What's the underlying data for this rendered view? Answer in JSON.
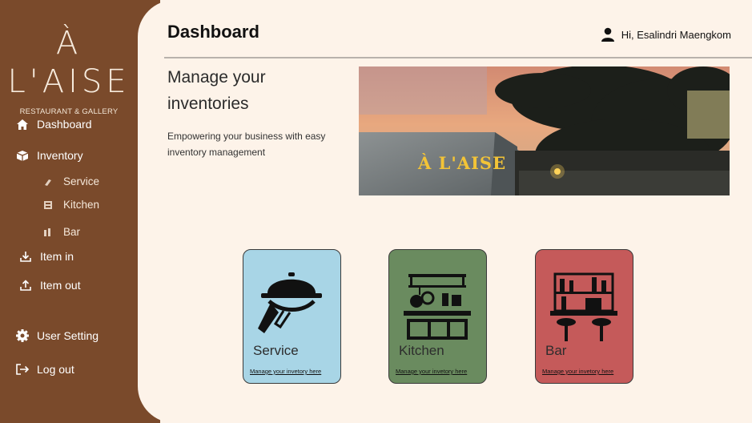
{
  "brand": {
    "logo_text": "À L'AISE",
    "subtitle": "RESTAURANT & GALLERY"
  },
  "sidebar": {
    "items": [
      {
        "label": "Dashboard",
        "icon": "home-icon"
      },
      {
        "label": "Inventory",
        "icon": "box-icon"
      },
      {
        "label": "Service",
        "icon": "service-icon"
      },
      {
        "label": "Kitchen",
        "icon": "kitchen-icon"
      },
      {
        "label": "Bar",
        "icon": "bar-icon"
      },
      {
        "label": "Item in",
        "icon": "download-icon"
      },
      {
        "label": "Item out",
        "icon": "upload-icon"
      },
      {
        "label": "User Setting",
        "icon": "gear-icon"
      },
      {
        "label": "Log out",
        "icon": "logout-icon"
      }
    ]
  },
  "header": {
    "title": "Dashboard",
    "greeting": "Hi, Esalindri Maengkom"
  },
  "hero": {
    "title": "Manage your inventories",
    "description": "Empowering your business with easy inventory management",
    "sign_text": "À L'AISE"
  },
  "cards": [
    {
      "label": "Service",
      "link": "Manage your invetory here",
      "color": "#a8d5e6"
    },
    {
      "label": "Kitchen",
      "link": "Manage your invetory here",
      "color": "#6a8b5f"
    },
    {
      "label": "Bar",
      "link": "Manage your invetory here",
      "color": "#c55a5a"
    }
  ],
  "colors": {
    "sidebar": "#7a4a2b",
    "background": "#fdf3e9"
  }
}
